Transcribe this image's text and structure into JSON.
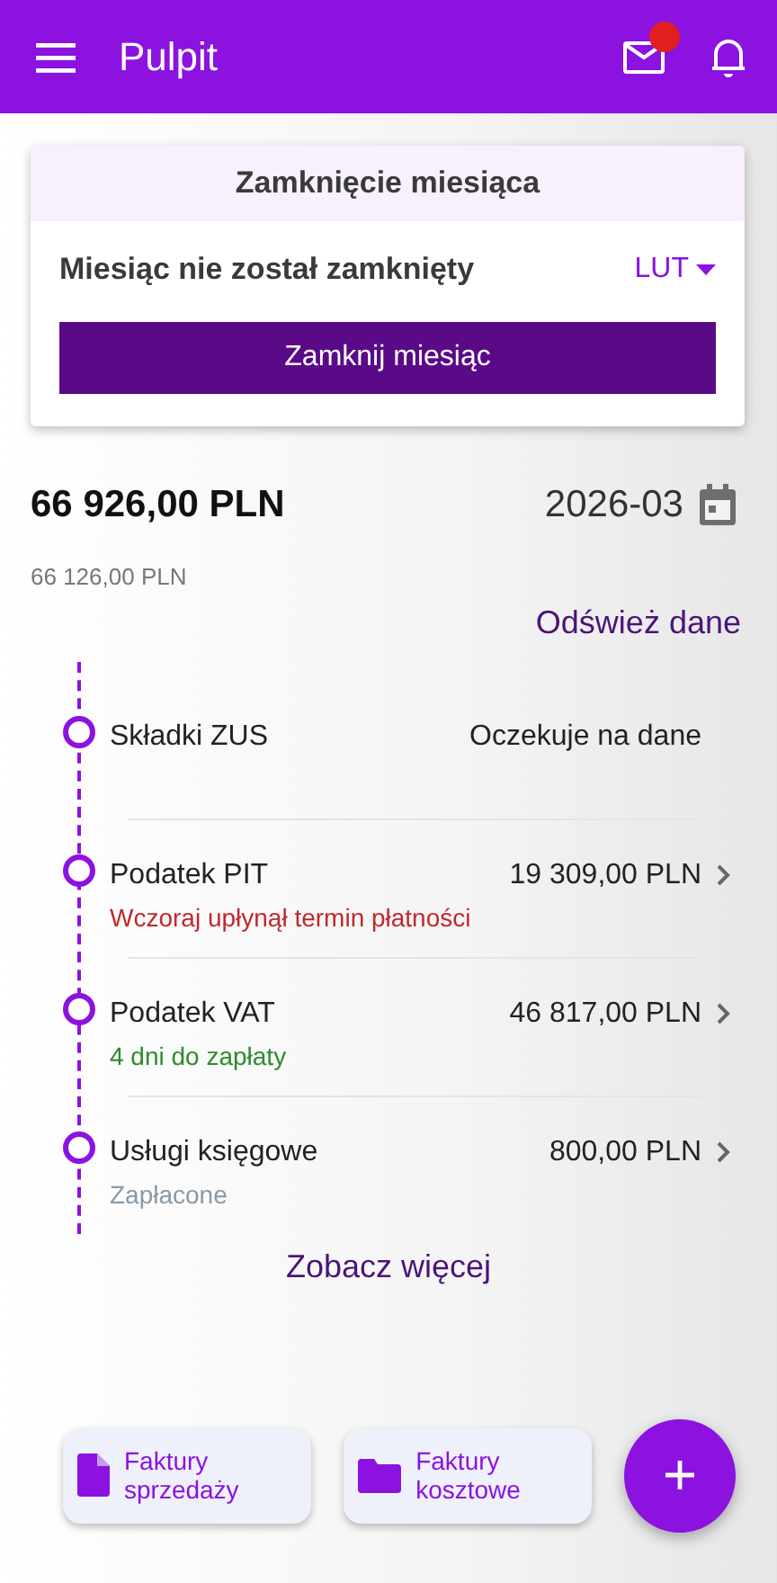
{
  "app_bar": {
    "title": "Pulpit",
    "mail_unread": true
  },
  "month_close": {
    "title": "Zamknięcie miesiąca",
    "status": "Miesiąc nie został zamknięty",
    "month": "LUT",
    "button": "Zamknij miesiąc"
  },
  "summary": {
    "total": "66 926,00 PLN",
    "period": "2026-03",
    "subtotal": "66 126,00 PLN",
    "refresh": "Odśwież dane"
  },
  "timeline": [
    {
      "name": "Składki ZUS",
      "value": "Oczekuje na dane",
      "link": false
    },
    {
      "name": "Podatek PIT",
      "value": "19 309,00 PLN",
      "link": true,
      "status": "Wczoraj upłynął termin płatności",
      "kind": "overdue"
    },
    {
      "name": "Podatek VAT",
      "value": "46 817,00 PLN",
      "link": true,
      "status": "4 dni do zapłaty",
      "kind": "upcoming"
    },
    {
      "name": "Usługi księgowe",
      "value": "800,00 PLN",
      "link": true,
      "status": "Zapłacone",
      "kind": "paid"
    }
  ],
  "more": "Zobacz więcej",
  "shortcuts": [
    {
      "label": "Faktury sprzedaży",
      "kind": "file"
    },
    {
      "label": "Faktury kosztowe",
      "kind": "folder"
    }
  ]
}
